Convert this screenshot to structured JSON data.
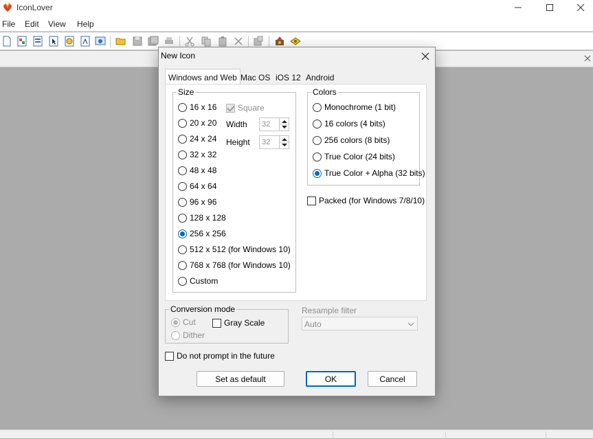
{
  "app": {
    "title": "IconLover"
  },
  "menu": [
    "File",
    "Edit",
    "View",
    "Help"
  ],
  "dialog": {
    "title": "New Icon",
    "tabs": [
      "Windows and Web",
      "Mac OS",
      "iOS 12",
      "Android"
    ],
    "size_group": {
      "label": "Size",
      "options": [
        "16 x 16",
        "20 x 20",
        "24 x 24",
        "32 x 32",
        "48 x 48",
        "64 x 64",
        "96 x 96",
        "128 x 128",
        "256 x 256",
        "512 x 512 (for Windows 10)",
        "768 x 768 (for Windows 10)",
        "Custom"
      ],
      "selected": "256 x 256",
      "square_label": "Square",
      "width_label": "Width",
      "width_value": "32",
      "height_label": "Height",
      "height_value": "32"
    },
    "colors_group": {
      "label": "Colors",
      "options": [
        "Monochrome (1 bit)",
        "16 colors (4 bits)",
        "256 colors (8 bits)",
        "True Color (24 bits)",
        "True Color + Alpha (32 bits)"
      ],
      "selected": "True Color + Alpha (32 bits)"
    },
    "packed_label": "Packed (for Windows 7/8/10)",
    "conversion": {
      "label": "Conversion mode",
      "cut": "Cut",
      "dither": "Dither",
      "grayscale": "Gray Scale"
    },
    "resample": {
      "label": "Resample filter",
      "value": "Auto"
    },
    "no_prompt_label": "Do not prompt in the future",
    "buttons": {
      "set_default": "Set as default",
      "ok": "OK",
      "cancel": "Cancel"
    }
  },
  "colors": {
    "accent": "#0067c0",
    "workspace": "#ababab",
    "dialog_bg": "#f0f0f0"
  }
}
